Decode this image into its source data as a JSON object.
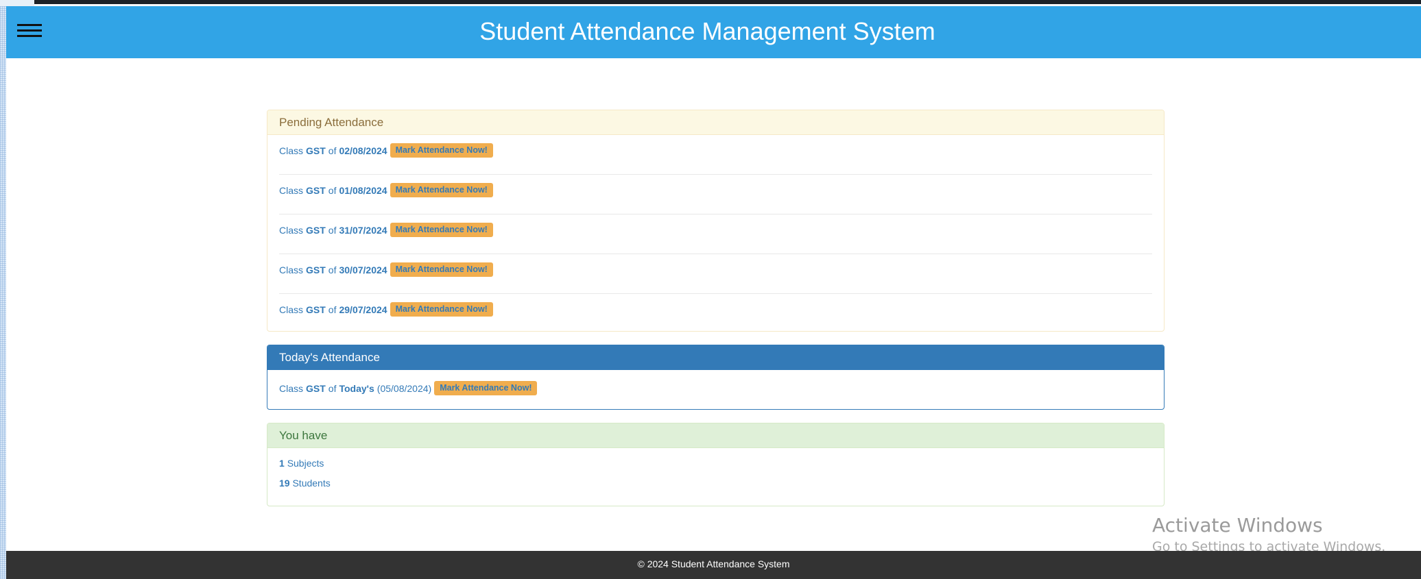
{
  "header": {
    "title": "Student Attendance Management System",
    "menu_icon": "hamburger-menu-icon",
    "background": "#31a4e6"
  },
  "pending": {
    "heading": "Pending Attendance",
    "items": [
      {
        "prefix": "Class",
        "subject": "GST",
        "of": "of",
        "date": "02/08/2024",
        "action": "Mark Attendance Now!"
      },
      {
        "prefix": "Class",
        "subject": "GST",
        "of": "of",
        "date": "01/08/2024",
        "action": "Mark Attendance Now!"
      },
      {
        "prefix": "Class",
        "subject": "GST",
        "of": "of",
        "date": "31/07/2024",
        "action": "Mark Attendance Now!"
      },
      {
        "prefix": "Class",
        "subject": "GST",
        "of": "of",
        "date": "30/07/2024",
        "action": "Mark Attendance Now!"
      },
      {
        "prefix": "Class",
        "subject": "GST",
        "of": "of",
        "date": "29/07/2024",
        "action": "Mark Attendance Now!"
      }
    ]
  },
  "today": {
    "heading": "Today's Attendance",
    "prefix": "Class",
    "subject": "GST",
    "of": "of",
    "day": "Today's",
    "date": "(05/08/2024)",
    "action": "Mark Attendance Now!"
  },
  "summary": {
    "heading": "You have",
    "subjects_count": "1",
    "subjects_label": "Subjects",
    "students_count": "19",
    "students_label": "Students"
  },
  "watermark": {
    "title": "Activate Windows",
    "subtitle": "Go to Settings to activate Windows."
  },
  "footer": {
    "text": "© 2024 Student Attendance System"
  },
  "colors": {
    "accent": "#31a4e6",
    "warning": "#f0ad4e",
    "primary": "#337ab7",
    "success": "#dff0d8",
    "footer": "#333333"
  }
}
